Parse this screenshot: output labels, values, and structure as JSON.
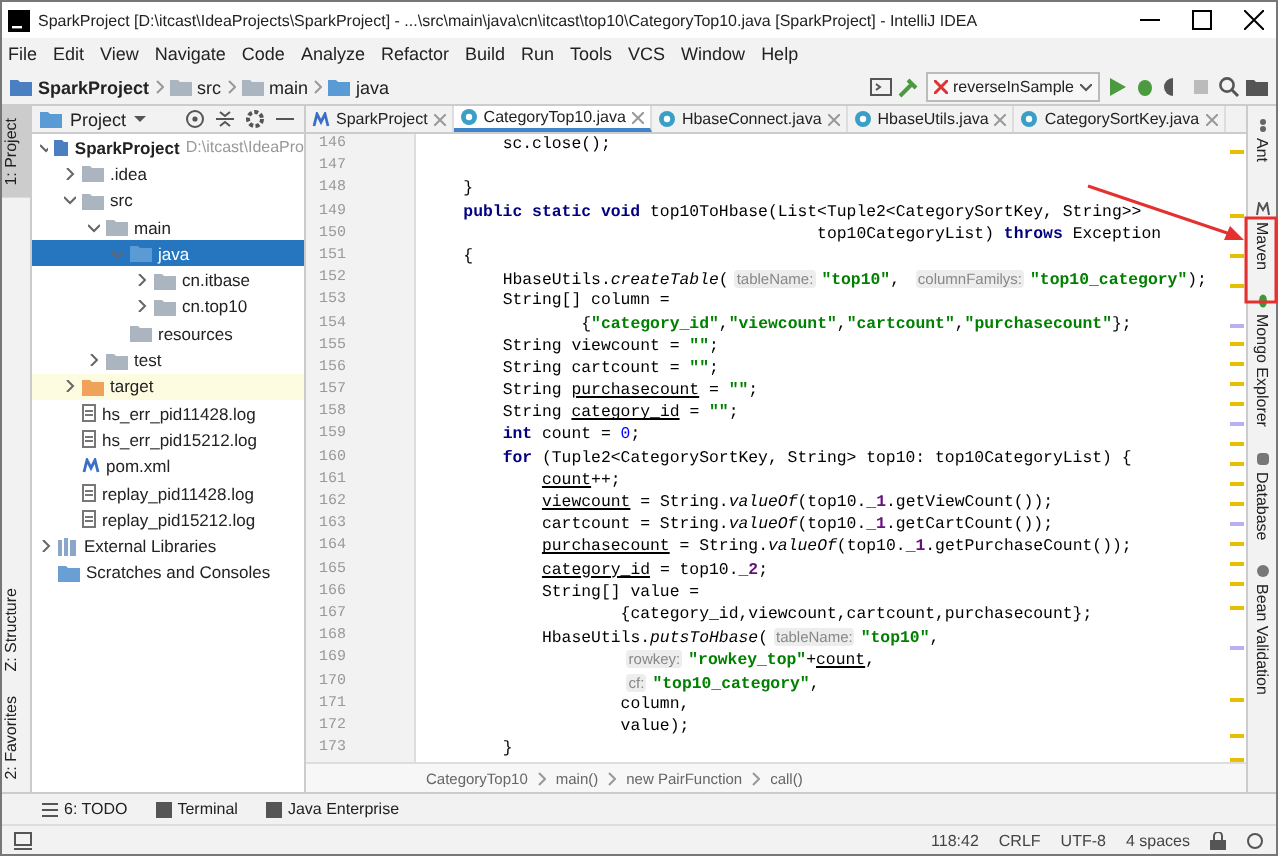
{
  "window": {
    "title": "SparkProject [D:\\itcast\\IdeaProjects\\SparkProject] - ...\\src\\main\\java\\cn\\itcast\\top10\\CategoryTop10.java [SparkProject] - IntelliJ IDEA"
  },
  "menu": [
    "File",
    "Edit",
    "View",
    "Navigate",
    "Code",
    "Analyze",
    "Refactor",
    "Build",
    "Run",
    "Tools",
    "VCS",
    "Window",
    "Help"
  ],
  "nav_breadcrumb": [
    {
      "label": "SparkProject",
      "kind": "module"
    },
    {
      "label": "src",
      "kind": "folder"
    },
    {
      "label": "main",
      "kind": "folder"
    },
    {
      "label": "java",
      "kind": "source"
    }
  ],
  "run_config": "reverseInSample",
  "left_strip": [
    {
      "label": "1: Project",
      "selected": true
    },
    {
      "label": "Z: Structure",
      "selected": false
    },
    {
      "label": "2: Favorites",
      "selected": false
    }
  ],
  "project_panel": {
    "title": "Project",
    "tree": [
      {
        "label": "SparkProject",
        "path": "D:\\itcast\\IdeaPro",
        "kind": "module",
        "expanded": true,
        "selected": false,
        "children": [
          {
            "label": ".idea",
            "kind": "folder",
            "expanded": false,
            "selected": false
          },
          {
            "label": "src",
            "kind": "folder",
            "expanded": true,
            "selected": false,
            "children": [
              {
                "label": "main",
                "kind": "folder",
                "expanded": true,
                "selected": false,
                "children": [
                  {
                    "label": "java",
                    "kind": "source",
                    "expanded": true,
                    "selected": true,
                    "children": [
                      {
                        "label": "cn.itbase",
                        "kind": "package",
                        "expanded": false,
                        "selected": false
                      },
                      {
                        "label": "cn.top10",
                        "kind": "package",
                        "expanded": false,
                        "selected": false
                      }
                    ]
                  },
                  {
                    "label": "resources",
                    "kind": "resources",
                    "selected": false
                  }
                ]
              },
              {
                "label": "test",
                "kind": "folder",
                "expanded": false,
                "selected": false
              }
            ]
          },
          {
            "label": "target",
            "kind": "excluded",
            "expanded": false,
            "selected": false
          },
          {
            "label": "hs_err_pid11428.log",
            "kind": "log",
            "selected": false
          },
          {
            "label": "hs_err_pid15212.log",
            "kind": "log",
            "selected": false
          },
          {
            "label": "pom.xml",
            "kind": "maven",
            "selected": false
          },
          {
            "label": "replay_pid11428.log",
            "kind": "log",
            "selected": false
          },
          {
            "label": "replay_pid15212.log",
            "kind": "log",
            "selected": false
          }
        ]
      },
      {
        "label": "External Libraries",
        "kind": "libraries",
        "expanded": false,
        "selected": false
      },
      {
        "label": "Scratches and Consoles",
        "kind": "scratches",
        "selected": false
      }
    ]
  },
  "tabs": [
    {
      "label": "SparkProject",
      "kind": "maven",
      "selected": false
    },
    {
      "label": "CategoryTop10.java",
      "kind": "class",
      "selected": true
    },
    {
      "label": "HbaseConnect.java",
      "kind": "class",
      "selected": false
    },
    {
      "label": "HbaseUtils.java",
      "kind": "class",
      "selected": false
    },
    {
      "label": "CategorySortKey.java",
      "kind": "class",
      "selected": false
    }
  ],
  "code": [
    {
      "number": "146",
      "tokens": [
        {
          "kind": "plain",
          "text": "        sc.close();"
        }
      ]
    },
    {
      "number": "147"
    },
    {
      "number": "148",
      "tokens": [
        {
          "kind": "plain",
          "text": "    }"
        }
      ]
    },
    {
      "number": "149",
      "tokens": [
        {
          "kind": "keyword",
          "text": "    public static void "
        },
        {
          "kind": "plain",
          "text": "top10ToHbase(List<Tuple2<CategorySortKey, String>>"
        }
      ]
    },
    {
      "number": "150",
      "tokens": [
        {
          "kind": "plain",
          "text": "                                        top10CategoryList) "
        },
        {
          "kind": "keyword",
          "text": "throws "
        },
        {
          "kind": "plain",
          "text": "Exception"
        }
      ]
    },
    {
      "number": "151",
      "tokens": [
        {
          "kind": "plain",
          "text": "    {"
        }
      ]
    },
    {
      "number": "152",
      "tokens": [
        {
          "kind": "plain",
          "text": "        HbaseUtils."
        },
        {
          "kind": "static_call",
          "text": "createTable"
        },
        {
          "kind": "plain",
          "text": "("
        },
        {
          "kind": "hint",
          "text": "tableName:"
        },
        {
          "kind": "string",
          "text": "\"top10\""
        },
        {
          "kind": "plain",
          "text": ", "
        },
        {
          "kind": "hint",
          "text": "columnFamilys:"
        },
        {
          "kind": "string",
          "text": "\"top10_category\""
        },
        {
          "kind": "plain",
          "text": ");"
        }
      ]
    },
    {
      "number": "153",
      "tokens": [
        {
          "kind": "plain",
          "text": "        String[] column ="
        }
      ]
    },
    {
      "number": "154",
      "tokens": [
        {
          "kind": "plain",
          "text": "                {"
        },
        {
          "kind": "string",
          "text": "\"category_id\""
        },
        {
          "kind": "plain",
          "text": ","
        },
        {
          "kind": "string",
          "text": "\"viewcount\""
        },
        {
          "kind": "plain",
          "text": ","
        },
        {
          "kind": "string",
          "text": "\"cartcount\""
        },
        {
          "kind": "plain",
          "text": ","
        },
        {
          "kind": "string",
          "text": "\"purchasecount\""
        },
        {
          "kind": "plain",
          "text": "};"
        }
      ]
    },
    {
      "number": "155",
      "tokens": [
        {
          "kind": "plain",
          "text": "        String viewcount = "
        },
        {
          "kind": "string",
          "text": "\"\""
        },
        {
          "kind": "plain",
          "text": ";"
        }
      ]
    },
    {
      "number": "156",
      "tokens": [
        {
          "kind": "plain",
          "text": "        String cartcount = "
        },
        {
          "kind": "string",
          "text": "\"\""
        },
        {
          "kind": "plain",
          "text": ";"
        }
      ]
    },
    {
      "number": "157",
      "tokens": [
        {
          "kind": "plain",
          "text": "        String "
        },
        {
          "kind": "local",
          "text": "purchasecount"
        },
        {
          "kind": "plain",
          "text": " = "
        },
        {
          "kind": "string",
          "text": "\"\""
        },
        {
          "kind": "plain",
          "text": ";"
        }
      ]
    },
    {
      "number": "158",
      "tokens": [
        {
          "kind": "plain",
          "text": "        String "
        },
        {
          "kind": "local",
          "text": "category_id"
        },
        {
          "kind": "plain",
          "text": " = "
        },
        {
          "kind": "string",
          "text": "\"\""
        },
        {
          "kind": "plain",
          "text": ";"
        }
      ]
    },
    {
      "number": "159",
      "tokens": [
        {
          "kind": "keyword",
          "text": "        int "
        },
        {
          "kind": "plain",
          "text": "count = "
        },
        {
          "kind": "number",
          "text": "0"
        },
        {
          "kind": "plain",
          "text": ";"
        }
      ]
    },
    {
      "number": "160",
      "tokens": [
        {
          "kind": "keyword",
          "text": "        for "
        },
        {
          "kind": "plain",
          "text": "(Tuple2<CategorySortKey, String> top10: top10CategoryList) {"
        }
      ]
    },
    {
      "number": "161",
      "tokens": [
        {
          "kind": "local",
          "text": "            count"
        },
        {
          "kind": "plain",
          "text": "++;"
        }
      ]
    },
    {
      "number": "162",
      "tokens": [
        {
          "kind": "local",
          "text": "            viewcount"
        },
        {
          "kind": "plain",
          "text": " = String."
        },
        {
          "kind": "static_call",
          "text": "valueOf"
        },
        {
          "kind": "plain",
          "text": "(top10."
        },
        {
          "kind": "field",
          "text": "_1"
        },
        {
          "kind": "plain",
          "text": ".getViewCount());"
        }
      ]
    },
    {
      "number": "163",
      "tokens": [
        {
          "kind": "plain",
          "text": "            cartcount = String."
        },
        {
          "kind": "static_call",
          "text": "valueOf"
        },
        {
          "kind": "plain",
          "text": "(top10."
        },
        {
          "kind": "field",
          "text": "_1"
        },
        {
          "kind": "plain",
          "text": ".getCartCount());"
        }
      ]
    },
    {
      "number": "164",
      "tokens": [
        {
          "kind": "local",
          "text": "            purchasecount"
        },
        {
          "kind": "plain",
          "text": " = String."
        },
        {
          "kind": "static_call",
          "text": "valueOf"
        },
        {
          "kind": "plain",
          "text": "(top10."
        },
        {
          "kind": "field",
          "text": "_1"
        },
        {
          "kind": "plain",
          "text": ".getPurchaseCount());"
        }
      ]
    },
    {
      "number": "165",
      "tokens": [
        {
          "kind": "local",
          "text": "            category_id"
        },
        {
          "kind": "plain",
          "text": " = top10."
        },
        {
          "kind": "field",
          "text": "_2"
        },
        {
          "kind": "plain",
          "text": ";"
        }
      ]
    },
    {
      "number": "166",
      "tokens": [
        {
          "kind": "plain",
          "text": "            String[] value ="
        }
      ]
    },
    {
      "number": "167",
      "tokens": [
        {
          "kind": "plain",
          "text": "                    {category_id,viewcount,cartcount,purchasecount};"
        }
      ]
    },
    {
      "number": "168",
      "tokens": [
        {
          "kind": "plain",
          "text": "            HbaseUtils."
        },
        {
          "kind": "static_call",
          "text": "putsToHbase"
        },
        {
          "kind": "plain",
          "text": "("
        },
        {
          "kind": "hint",
          "text": "tableName:"
        },
        {
          "kind": "string",
          "text": "\"top10\""
        },
        {
          "kind": "plain",
          "text": ","
        }
      ]
    },
    {
      "number": "169",
      "tokens": [
        {
          "kind": "hint",
          "text": "                    rowkey:"
        },
        {
          "kind": "string",
          "text": "\"rowkey_top\""
        },
        {
          "kind": "plain",
          "text": "+"
        },
        {
          "kind": "local",
          "text": "count"
        },
        {
          "kind": "plain",
          "text": ","
        }
      ]
    },
    {
      "number": "170",
      "tokens": [
        {
          "kind": "hint",
          "text": "                    cf:"
        },
        {
          "kind": "string",
          "text": "\"top10_category\""
        },
        {
          "kind": "plain",
          "text": ","
        }
      ]
    },
    {
      "number": "171",
      "tokens": [
        {
          "kind": "plain",
          "text": "                    column,"
        }
      ]
    },
    {
      "number": "172",
      "tokens": [
        {
          "kind": "plain",
          "text": "                    value);"
        }
      ]
    },
    {
      "number": "173",
      "tokens": [
        {
          "kind": "plain",
          "text": "        }"
        }
      ]
    }
  ],
  "editor_breadcrumb": [
    "CategoryTop10",
    "main()",
    "new PairFunction",
    "call()"
  ],
  "right_strip": [
    {
      "label": "Ant",
      "kind": "ant"
    },
    {
      "label": "Maven",
      "kind": "maven"
    },
    {
      "label": "Mongo Explorer",
      "kind": "mongo"
    },
    {
      "label": "Database",
      "kind": "database"
    },
    {
      "label": "Bean Validation",
      "kind": "bean"
    }
  ],
  "bottom_tools": [
    {
      "label": "6: TODO",
      "kind": "todo"
    },
    {
      "label": "Terminal",
      "kind": "terminal"
    },
    {
      "label": "Java Enterprise",
      "kind": "enterprise"
    }
  ],
  "status_bar": {
    "position": "118:42",
    "line_separator": "CRLF",
    "encoding": "UTF-8",
    "indent": "4 spaces"
  }
}
